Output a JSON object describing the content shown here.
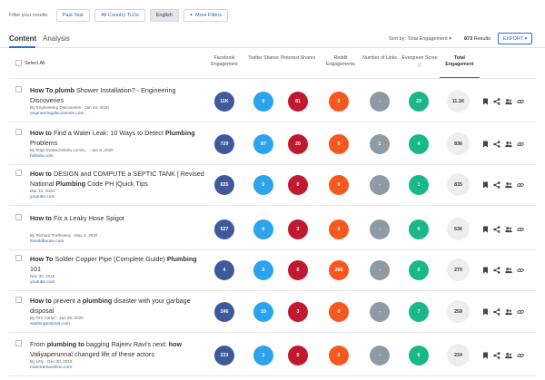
{
  "filter_bar": {
    "label": "Filter your results:",
    "buttons": [
      "Past Year",
      "All Country TLDs",
      "English",
      "More Filters"
    ]
  },
  "tabs": {
    "content": "Content",
    "analysis": "Analysis"
  },
  "sort": {
    "label": "Sort by: Total Engagement",
    "count": "873",
    "results_label": "Results",
    "export_label": "EXPORT"
  },
  "select_all": "Select All",
  "columns": [
    "Facebook Engagement",
    "Twitter Shares",
    "Pinterest Shares",
    "Reddit Engagements",
    "Number of Links",
    "Evergreen Score",
    "Total Engagement"
  ],
  "colors": {
    "facebook": "#3f5a9b",
    "twitter": "#2ca3ec",
    "pinterest": "#c0192f",
    "reddit": "#f6581f",
    "links": "#8f9ba4",
    "evergreen": "#19b78a",
    "accent": "#2673c9"
  },
  "rows": [
    {
      "title_parts": [
        {
          "t": "How To plumb",
          "b": true
        },
        {
          "t": " Shower Installation? - Engineering Discoveries",
          "b": false
        }
      ],
      "meta": "By Engineering Discoveries - Jan 24, 2020",
      "domain": "engineeringdiscoveries.com",
      "facebook": "11K",
      "twitter": "0",
      "pinterest": "81",
      "reddit": "0",
      "links": "-",
      "evergreen": "23",
      "total": "11.1K"
    },
    {
      "title_parts": [
        {
          "t": "How to",
          "b": true
        },
        {
          "t": " Find a Water Leak: 10 Ways to Detect ",
          "b": false
        },
        {
          "t": "Plumbing",
          "b": true
        },
        {
          "t": " Problems",
          "b": false
        }
      ],
      "meta": "By https://www.bobvila.com/a... - Jan 8, 2020",
      "domain": "bobvila.com",
      "facebook": "729",
      "twitter": "87",
      "pinterest": "20",
      "reddit": "0",
      "links": "1",
      "evergreen": "4",
      "total": "836"
    },
    {
      "title_parts": [
        {
          "t": "How to",
          "b": true
        },
        {
          "t": " DESIGN and COMPUTE a SEPTIC TANK | Revised National ",
          "b": false
        },
        {
          "t": "Plumbing",
          "b": true
        },
        {
          "t": " Code PH |Quick Tips",
          "b": false
        }
      ],
      "meta": "Mar 15, 2020",
      "domain": "youtube.com",
      "facebook": "835",
      "twitter": "0",
      "pinterest": "0",
      "reddit": "0",
      "links": "-",
      "evergreen": "1",
      "total": "835"
    },
    {
      "title_parts": [
        {
          "t": "How to",
          "b": true
        },
        {
          "t": " Fix a Leaky Hose Spigot",
          "b": false
        }
      ],
      "meta": "By Richard Trethewey - May 3, 2020",
      "domain": "thisoldhouse.com",
      "facebook": "627",
      "twitter": "6",
      "pinterest": "3",
      "reddit": "0",
      "links": "-",
      "evergreen": "0",
      "total": "636"
    },
    {
      "title_parts": [
        {
          "t": "How To",
          "b": true
        },
        {
          "t": " Solder Copper Pipe (Complete Guide) ",
          "b": false
        },
        {
          "t": "Plumbing",
          "b": true
        },
        {
          "t": " 101",
          "b": false
        }
      ],
      "meta": "Nov 30, 2019",
      "domain": "youtube.com",
      "facebook": "4",
      "twitter": "0",
      "pinterest": "0",
      "reddit": "266",
      "links": "-",
      "evergreen": "0",
      "total": "270"
    },
    {
      "title_parts": [
        {
          "t": "How to",
          "b": true
        },
        {
          "t": " prevent a ",
          "b": false
        },
        {
          "t": "plumbing",
          "b": true
        },
        {
          "t": " disaster with your garbage disposal",
          "b": false
        }
      ],
      "meta": "By Tim Carter - Jan 28, 2020",
      "domain": "washingtonpost.com",
      "facebook": "246",
      "twitter": "10",
      "pinterest": "3",
      "reddit": "0",
      "links": "-",
      "evergreen": "7",
      "total": "259"
    },
    {
      "title_parts": [
        {
          "t": "From ",
          "b": false
        },
        {
          "t": "plumbing to",
          "b": true
        },
        {
          "t": " bagging Rajeev Ravi's next: ",
          "b": false
        },
        {
          "t": "how",
          "b": true
        },
        {
          "t": " Valiyaperunnal changed life of these actors",
          "b": false
        }
      ],
      "meta": "By Litty - Dec 30, 2019",
      "domain": "manoramaonline.com",
      "facebook": "233",
      "twitter": "1",
      "pinterest": "0",
      "reddit": "0",
      "links": "-",
      "evergreen": "6",
      "total": "234"
    }
  ]
}
